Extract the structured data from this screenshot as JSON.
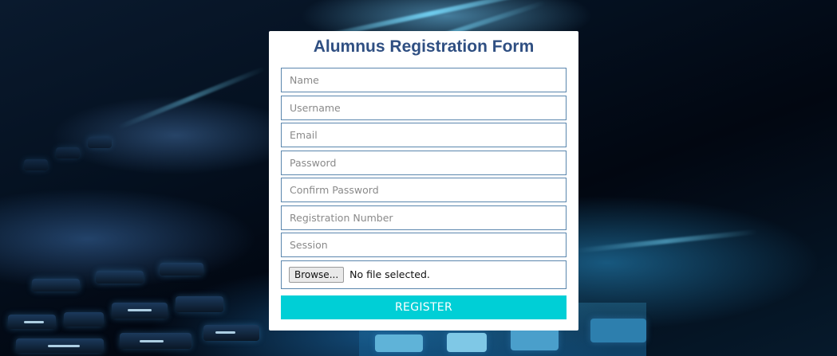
{
  "form": {
    "title": "Alumnus Registration Form",
    "fields": [
      {
        "placeholder": "Name",
        "value": ""
      },
      {
        "placeholder": "Username",
        "value": ""
      },
      {
        "placeholder": "Email",
        "value": ""
      },
      {
        "placeholder": "Password",
        "value": ""
      },
      {
        "placeholder": "Confirm Password",
        "value": ""
      },
      {
        "placeholder": "Registration Number",
        "value": ""
      },
      {
        "placeholder": "Session",
        "value": ""
      }
    ],
    "file_input": {
      "button_label": "Browse...",
      "status": "No file selected."
    },
    "submit_label": "REGISTER"
  },
  "colors": {
    "title": "#2f4f82",
    "field_border": "#5a86ad",
    "register_button": "#00cfd6",
    "card_background": "#ffffff"
  }
}
